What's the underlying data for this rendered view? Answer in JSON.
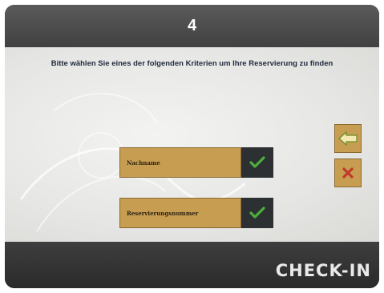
{
  "header": {
    "step_number": "4"
  },
  "main": {
    "instruction": "Bitte wählen Sie eines der folgenden Kriterien um Ihre Reservierung zu finden",
    "options": [
      {
        "label": "Nachname",
        "confirm_icon": "checkmark-icon"
      },
      {
        "label": "Reservierungsnummer",
        "confirm_icon": "checkmark-icon"
      }
    ],
    "side_buttons": {
      "back_icon": "arrow-left-icon",
      "cancel_icon": "close-x-icon"
    }
  },
  "footer": {
    "brand": "CHECK-IN"
  },
  "colors": {
    "header_bg": "#4b4b4b",
    "button_gold": "#c79d52",
    "check_bg": "#2c3032",
    "check_green": "#4caf3a",
    "cancel_red": "#c0392b"
  }
}
